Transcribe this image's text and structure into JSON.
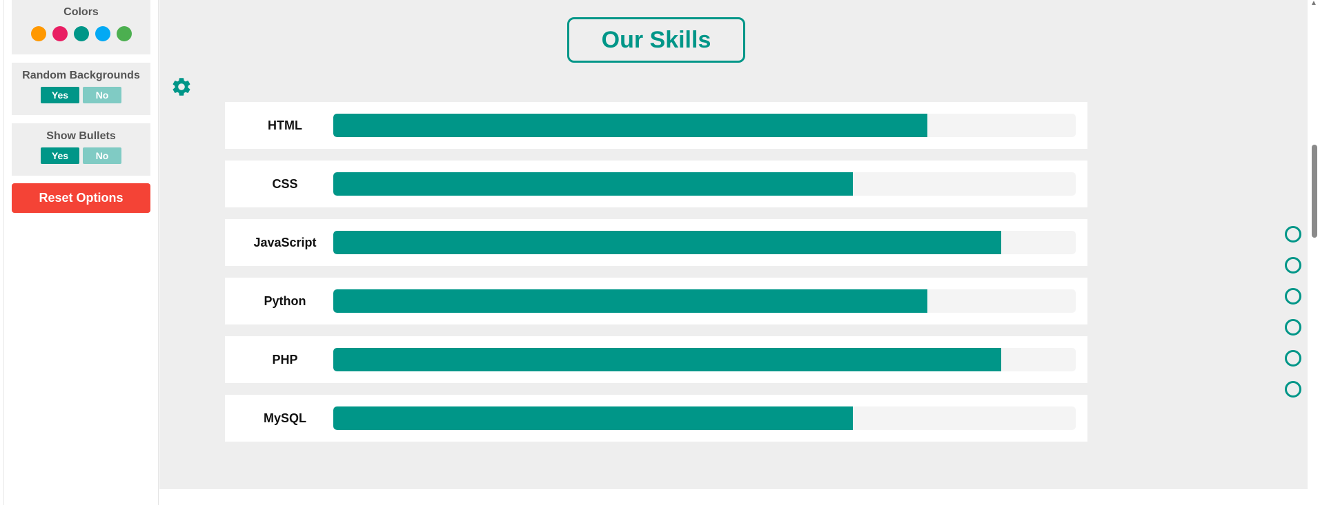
{
  "settings": {
    "colors_title": "Colors",
    "colors": [
      "#ff9800",
      "#e91e63",
      "#009688",
      "#03a9f4",
      "#4caf50"
    ],
    "random_backgrounds": {
      "title": "Random Backgrounds",
      "yes": "Yes",
      "no": "No",
      "selected": "Yes"
    },
    "show_bullets": {
      "title": "Show Bullets",
      "yes": "Yes",
      "no": "No",
      "selected": "Yes"
    },
    "reset_label": "Reset Options"
  },
  "section": {
    "title": "Our Skills",
    "skills": [
      {
        "name": "HTML",
        "progress": 0.8
      },
      {
        "name": "CSS",
        "progress": 0.7
      },
      {
        "name": "JavaScript",
        "progress": 0.9
      },
      {
        "name": "Python",
        "progress": 0.8
      },
      {
        "name": "PHP",
        "progress": 0.9
      },
      {
        "name": "MySQL",
        "progress": 0.7
      }
    ]
  },
  "bullets": {
    "count": 6
  },
  "theme": {
    "accent": "#009688",
    "accent_light": "#80cbc4",
    "danger": "#f44336",
    "section_bg": "#eeeeee"
  }
}
